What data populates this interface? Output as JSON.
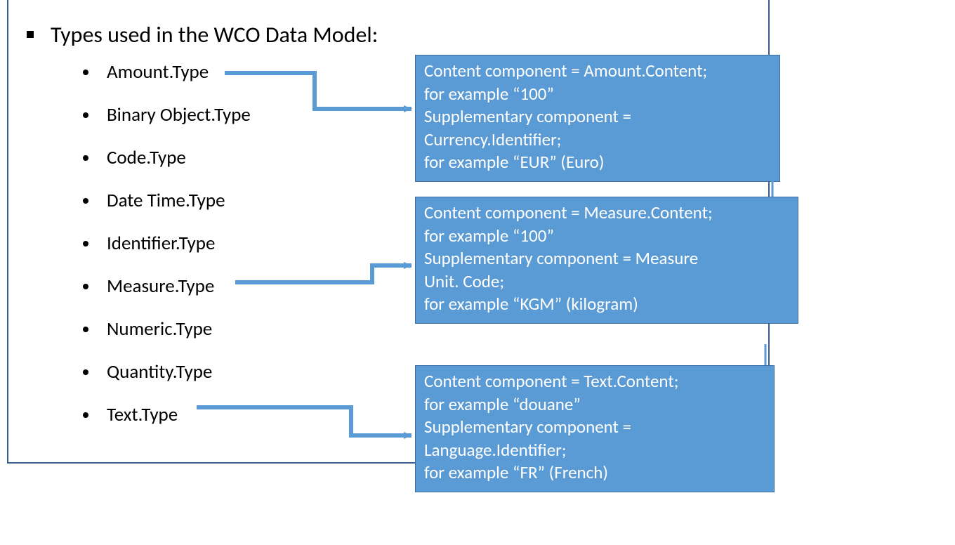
{
  "heading": "Types used in the WCO Data Model:",
  "types": {
    "t0": "Amount.Type",
    "t1": "Binary Object.Type",
    "t2": "Code.Type",
    "t3": "Date Time.Type",
    "t4": "Identifier.Type",
    "t5": "Measure.Type",
    "t6": "Numeric.Type",
    "t7": "Quantity.Type",
    "t8": "Text.Type"
  },
  "callouts": {
    "c1": {
      "l1": "Content component = Amount.Content;",
      "l2": "for example “100”",
      "l3": "Supplementary component =",
      "l4": "Currency.Identifier;",
      "l5": "for example “EUR” (Euro)"
    },
    "c2": {
      "l1": "Content component = Measure.Content;",
      "l2": "for example “100”",
      "l3": "Supplementary component = Measure",
      "l4": "Unit. Code;",
      "l5": "for example “KGM” (kilogram)"
    },
    "c3": {
      "l1": "Content component = Text.Content;",
      "l2": "for example “douane”",
      "l3": "Supplementary component =",
      "l4": "Language.Identifier;",
      "l5": "for example “FR” (French)"
    }
  },
  "colors": {
    "callout_bg": "#5b9bd5",
    "border": "#3a5c8c",
    "arrow": "#5b9bd5"
  }
}
